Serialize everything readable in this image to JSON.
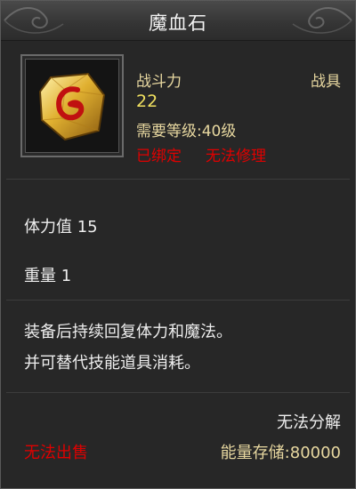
{
  "item": {
    "name": "魔血石",
    "combat_power_label": "战斗力",
    "category": "战具",
    "combat_power_value": "22",
    "level_requirement": "需要等级:40级",
    "bound_status": "已绑定",
    "repair_status": "无法修理"
  },
  "attributes": {
    "stamina": "体力值 15",
    "weight": "重量 1"
  },
  "description": {
    "line1": "装备后持续回复体力和魔法。",
    "line2": "并可替代技能道具消耗。"
  },
  "footer": {
    "decompose": "无法分解",
    "sell": "无法出售",
    "energy": "能量存储:80000"
  },
  "icon": "rune-stone-icon",
  "colors": {
    "title": "#f2f2f2",
    "label": "#e8d8a0",
    "value": "#f0e060",
    "warning": "#e00000"
  }
}
